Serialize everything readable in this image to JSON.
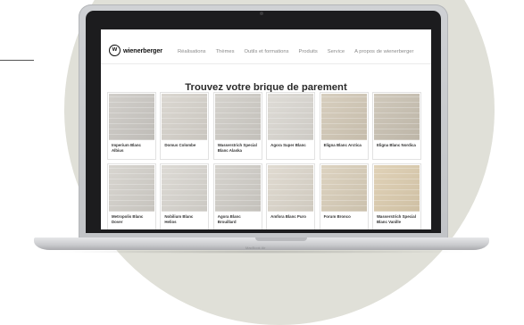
{
  "brand": {
    "logo_glyph": "w",
    "name": "wienerberger"
  },
  "nav": {
    "items": [
      {
        "label": "Réalisations"
      },
      {
        "label": "Thèmes"
      },
      {
        "label": "Outils et formations"
      },
      {
        "label": "Produits"
      },
      {
        "label": "Service"
      },
      {
        "label": "A propos de wienerberger"
      }
    ]
  },
  "page": {
    "title": "Trouvez votre brique de parement"
  },
  "products": [
    {
      "name": "Imperium Blanc Albius",
      "swatch": "#cbc8c3"
    },
    {
      "name": "Domus Colombe",
      "swatch": "#d6d2cb"
    },
    {
      "name": "Wasserstrich Special Blanc Alaska",
      "swatch": "#cfccc6"
    },
    {
      "name": "Agora Super Blanc",
      "swatch": "#dad7d1"
    },
    {
      "name": "Eligna Blanc Arctica",
      "swatch": "#d2c8b6"
    },
    {
      "name": "Eligna Blanc Nordica",
      "swatch": "#c9c1b2"
    },
    {
      "name": "Metropolis Blanc Dover",
      "swatch": "#d3d0ca"
    },
    {
      "name": "Nobilium Blanc Helios",
      "swatch": "#d8d5cf"
    },
    {
      "name": "Agora Blanc Brouillard",
      "swatch": "#d0cdc7"
    },
    {
      "name": "Amfora Blanc Puro",
      "swatch": "#dcd6cb"
    },
    {
      "name": "Forum Bronco",
      "swatch": "#d8cdb8"
    },
    {
      "name": "Wasserstrich Special Blanc Vanille",
      "swatch": "#dcccae"
    }
  ],
  "device": {
    "brand": "MacBook Air"
  }
}
